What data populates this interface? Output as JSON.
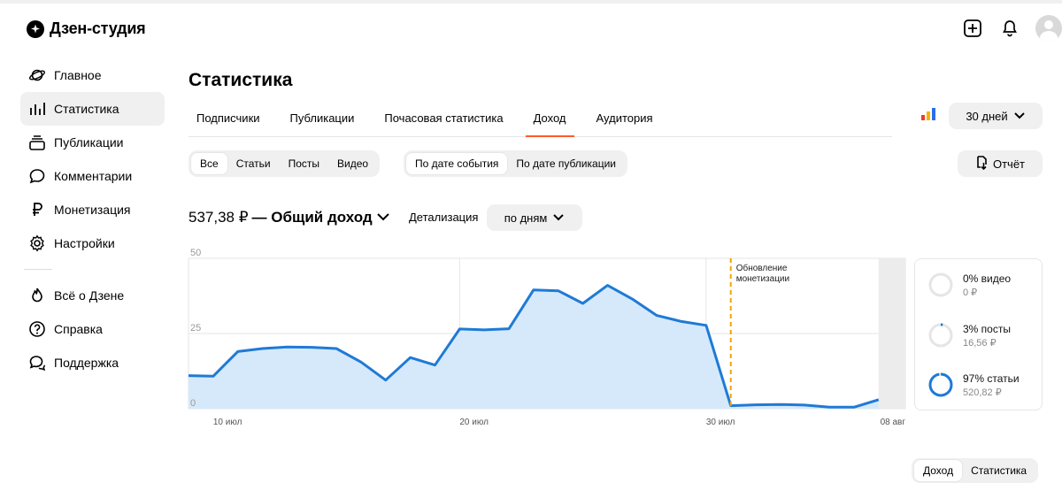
{
  "app": {
    "title": "Дзен-студия"
  },
  "sidebar": {
    "items": [
      {
        "label": "Главное",
        "icon": "planet-icon",
        "active": false
      },
      {
        "label": "Статистика",
        "icon": "bar-chart-icon",
        "active": true
      },
      {
        "label": "Публикации",
        "icon": "stack-icon",
        "active": false
      },
      {
        "label": "Комментарии",
        "icon": "comment-icon",
        "active": false
      },
      {
        "label": "Монетизация",
        "icon": "ruble-icon",
        "active": false
      },
      {
        "label": "Настройки",
        "icon": "gear-icon",
        "active": false
      }
    ],
    "secondary": [
      {
        "label": "Всё о Дзене",
        "icon": "flame-icon"
      },
      {
        "label": "Справка",
        "icon": "help-icon"
      },
      {
        "label": "Поддержка",
        "icon": "support-icon"
      }
    ]
  },
  "page": {
    "title": "Статистика"
  },
  "tabs": [
    {
      "label": "Подписчики",
      "active": false
    },
    {
      "label": "Публикации",
      "active": false
    },
    {
      "label": "Почасовая статистика",
      "active": false
    },
    {
      "label": "Доход",
      "active": true
    },
    {
      "label": "Аудитория",
      "active": false
    }
  ],
  "period": {
    "label": "30 дней"
  },
  "content_filter": {
    "options": [
      "Все",
      "Статьи",
      "Посты",
      "Видео"
    ],
    "selected": "Все"
  },
  "date_filter": {
    "options": [
      "По дате события",
      "По дате публикации"
    ],
    "selected": "По дате события"
  },
  "report_button": {
    "label": "Отчёт"
  },
  "summary": {
    "value": "537,38 ₽",
    "label": "— Общий доход"
  },
  "detail": {
    "label": "Детализация",
    "value": "по дням"
  },
  "breakdown": [
    {
      "percent_label": "0% видео",
      "amount": "0 ₽",
      "share": 0
    },
    {
      "percent_label": "3% посты",
      "amount": "16,56 ₽",
      "share": 0.03
    },
    {
      "percent_label": "97% статьи",
      "amount": "520,82 ₽",
      "share": 0.97
    }
  ],
  "bottom_toggle": {
    "options": [
      "Доход",
      "Статистика"
    ],
    "selected": "Доход"
  },
  "colors": {
    "accent": "#ff5a2a",
    "line": "#1f7ad6",
    "fill": "#d6e9fb",
    "marker": "#f0a500"
  },
  "chart_data": {
    "type": "area",
    "x": [
      "09 июл",
      "10 июл",
      "11 июл",
      "12 июл",
      "13 июл",
      "14 июл",
      "15 июл",
      "16 июл",
      "17 июл",
      "18 июл",
      "19 июл",
      "20 июл",
      "21 июл",
      "22 июл",
      "23 июл",
      "24 июл",
      "25 июл",
      "26 июл",
      "27 июл",
      "28 июл",
      "29 июл",
      "30 июл",
      "31 июл",
      "01 авг",
      "02 авг",
      "03 авг",
      "04 авг",
      "05 авг",
      "06 авг",
      "07 авг"
    ],
    "series": [
      {
        "values": [
          11,
          10.8,
          19,
          20,
          20.5,
          20.4,
          20,
          15.5,
          9.5,
          17,
          14.5,
          26.5,
          26.2,
          26.6,
          39.5,
          39.2,
          35,
          41,
          36.5,
          31,
          29,
          27.7,
          1,
          1.3,
          1.4,
          1.2,
          0.5,
          0.5,
          3
        ]
      }
    ],
    "xlabel": "",
    "ylabel": "",
    "ylim": [
      0,
      50
    ],
    "yticks": [
      "0",
      "25",
      "50"
    ],
    "xticks": [
      "10 июл",
      "20 июл",
      "30 июл",
      "08 авг"
    ],
    "annotation": {
      "x": "31 июл",
      "text": "Обновление монетизации"
    },
    "grid": true
  }
}
